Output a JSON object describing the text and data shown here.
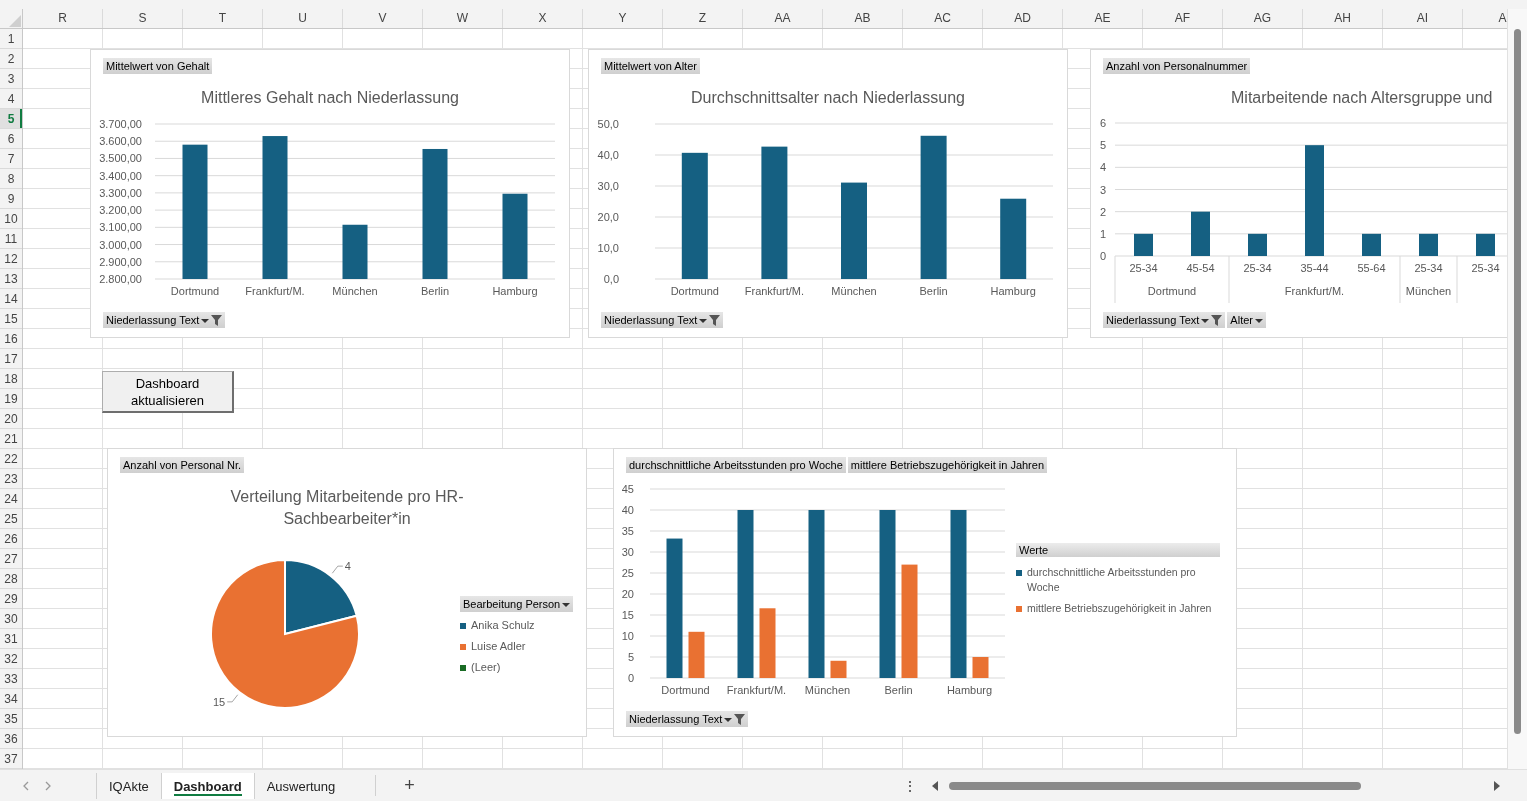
{
  "column_headers": [
    "R",
    "S",
    "T",
    "U",
    "V",
    "W",
    "X",
    "Y",
    "Z",
    "AA",
    "AB",
    "AC",
    "AD",
    "AE",
    "AF",
    "AG",
    "AH",
    "AI",
    "A"
  ],
  "row_headers": [
    {
      "label": "1",
      "selected": false
    },
    {
      "label": "2",
      "selected": false
    },
    {
      "label": "3",
      "selected": false
    },
    {
      "label": "4",
      "selected": false
    },
    {
      "label": "5",
      "selected": true
    },
    {
      "label": "6",
      "selected": false
    },
    {
      "label": "7",
      "selected": false
    },
    {
      "label": "8",
      "selected": false
    },
    {
      "label": "9",
      "selected": false
    },
    {
      "label": "10",
      "selected": false
    },
    {
      "label": "11",
      "selected": false
    },
    {
      "label": "12",
      "selected": false
    },
    {
      "label": "13",
      "selected": false
    },
    {
      "label": "14",
      "selected": false
    },
    {
      "label": "15",
      "selected": false
    },
    {
      "label": "16",
      "selected": false
    },
    {
      "label": "17",
      "selected": false
    },
    {
      "label": "18",
      "selected": false
    },
    {
      "label": "19",
      "selected": false
    },
    {
      "label": "20",
      "selected": false
    },
    {
      "label": "21",
      "selected": false
    },
    {
      "label": "22",
      "selected": false
    },
    {
      "label": "23",
      "selected": false
    },
    {
      "label": "24",
      "selected": false
    },
    {
      "label": "25",
      "selected": false
    },
    {
      "label": "26",
      "selected": false
    },
    {
      "label": "27",
      "selected": false
    },
    {
      "label": "28",
      "selected": false
    },
    {
      "label": "29",
      "selected": false
    },
    {
      "label": "30",
      "selected": false
    },
    {
      "label": "31",
      "selected": false
    },
    {
      "label": "32",
      "selected": false
    },
    {
      "label": "33",
      "selected": false
    },
    {
      "label": "34",
      "selected": false
    },
    {
      "label": "35",
      "selected": false
    },
    {
      "label": "36",
      "selected": false
    },
    {
      "label": "37",
      "selected": false
    }
  ],
  "charts": [
    {
      "title": "Mittleres Gehalt nach Niederlassung",
      "axis_fields": [
        {
          "label": "Niederlassung Text",
          "filtered": true
        }
      ],
      "chart_data": {
        "type": "bar",
        "categories": [
          "Dortmund",
          "Frankfurt/M.",
          "München",
          "Berlin",
          "Hamburg"
        ],
        "series": [
          {
            "name": "Mittelwert von Gehalt",
            "color": "#156082",
            "values": [
              3580,
              3630,
              3115,
              3555,
              3295
            ]
          }
        ],
        "grid": true,
        "ylim": [
          2800,
          3700
        ],
        "yticks": [
          {
            "value": 2800,
            "label": "2.800,00"
          },
          {
            "value": 2900,
            "label": "2.900,00"
          },
          {
            "value": 3000,
            "label": "3.000,00"
          },
          {
            "value": 3100,
            "label": "3.100,00"
          },
          {
            "value": 3200,
            "label": "3.200,00"
          },
          {
            "value": 3300,
            "label": "3.300,00"
          },
          {
            "value": 3400,
            "label": "3.400,00"
          },
          {
            "value": 3500,
            "label": "3.500,00"
          },
          {
            "value": 3600,
            "label": "3.600,00"
          },
          {
            "value": 3700,
            "label": "3.700,00"
          }
        ]
      }
    },
    {
      "title": "Durchschnittsalter nach Niederlassung",
      "axis_fields": [
        {
          "label": "Niederlassung Text",
          "filtered": true
        }
      ],
      "chart_data": {
        "type": "bar",
        "categories": [
          "Dortmund",
          "Frankfurt/M.",
          "München",
          "Berlin",
          "Hamburg"
        ],
        "series": [
          {
            "name": "Mittelwert von Alter",
            "color": "#156082",
            "values": [
              40.7,
              42.7,
              31.1,
              46.2,
              25.9
            ]
          }
        ],
        "grid": true,
        "ylim": [
          0,
          50
        ],
        "yticks": [
          {
            "value": 0,
            "label": "0,0"
          },
          {
            "value": 10,
            "label": "10,0"
          },
          {
            "value": 20,
            "label": "20,0"
          },
          {
            "value": 30,
            "label": "30,0"
          },
          {
            "value": 40,
            "label": "40,0"
          },
          {
            "value": 50,
            "label": "50,0"
          }
        ]
      }
    },
    {
      "title": "Mitarbeitende nach Altersgruppe und",
      "axis_fields": [
        {
          "label": "Niederlassung Text",
          "filtered": true
        },
        {
          "label": "Alter",
          "filtered": false
        }
      ],
      "chart_data": {
        "type": "bar",
        "categories": [
          "25-34",
          "45-54",
          "25-34",
          "35-44",
          "55-64",
          "25-34",
          "25-34"
        ],
        "annotations": [
          "Dortmund",
          "Frankfurt/M.",
          "München"
        ],
        "grid": true,
        "series": [
          {
            "name": "Anzahl von Personalnummer",
            "color": "#156082",
            "values": [
              1,
              2,
              1,
              5,
              1,
              1,
              1
            ]
          }
        ],
        "ylim": [
          0,
          6
        ],
        "yticks": [
          0,
          1,
          2,
          3,
          4,
          5,
          6
        ]
      }
    },
    {
      "value_fields": [
        {
          "label": "Anzahl von Personal Nr."
        }
      ],
      "title": "Verteilung Mitarbeitende pro HR-Sachbearbeiter*in",
      "legend_field": {
        "label": "Bearbeitung Person",
        "filtered": false
      },
      "chart_data": {
        "type": "pie",
        "categories": [
          "Anika Schulz",
          "Luise Adler",
          "(Leer)"
        ],
        "values": [
          4,
          15,
          0
        ],
        "colors": [
          "#156082",
          "#e97132",
          "#196b24"
        ],
        "data_labels": true
      }
    },
    {
      "value_fields": [
        {
          "label": "durchschnittliche  Arbeitsstunden pro Woche"
        },
        {
          "label": "mittlere Betriebszugehörigkeit in Jahren"
        }
      ],
      "legend_title": "Werte",
      "axis_fields": [
        {
          "label": "Niederlassung Text",
          "filtered": true
        }
      ],
      "chart_data": {
        "type": "bar",
        "categories": [
          "Dortmund",
          "Frankfurt/M.",
          "München",
          "Berlin",
          "Hamburg"
        ],
        "series": [
          {
            "name": "durchschnittliche Arbeitsstunden pro Woche",
            "color": "#156082",
            "values": [
              33.2,
              40,
              40,
              40,
              40
            ]
          },
          {
            "name": "mittlere Betriebszugehörigkeit in Jahren",
            "color": "#e97132",
            "values": [
              11,
              16.6,
              4.1,
              27,
              5
            ]
          }
        ],
        "grid": true,
        "ylim": [
          0,
          45
        ],
        "yticks": [
          0,
          5,
          10,
          15,
          20,
          25,
          30,
          35,
          40,
          45
        ]
      }
    }
  ],
  "button": {
    "label": "Dashboard aktualisieren"
  },
  "sheet_tabs": [
    {
      "label": "IQAkte",
      "selected": false
    },
    {
      "label": "Dashboard",
      "selected": true
    },
    {
      "label": "Auswertung",
      "selected": false
    }
  ],
  "add_sheet": "+",
  "more_menu": "⋮"
}
